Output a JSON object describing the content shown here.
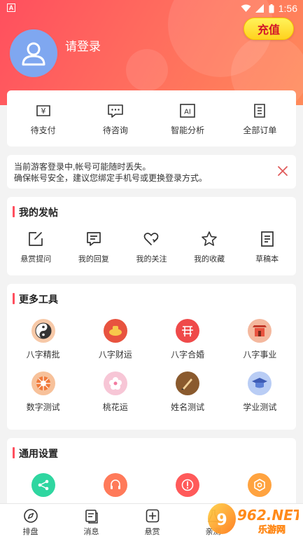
{
  "status": {
    "time": "1:56",
    "badge": "A"
  },
  "user": {
    "login_text": "请登录",
    "recharge_label": "充值"
  },
  "orders": [
    {
      "label": "待支付",
      "icon": "yuan-ticket-icon"
    },
    {
      "label": "待咨询",
      "icon": "chat-bubble-icon"
    },
    {
      "label": "智能分析",
      "icon": "ai-icon"
    },
    {
      "label": "全部订单",
      "icon": "list-doc-icon"
    }
  ],
  "notice": {
    "line1": "当前游客登录中,帐号可能随时丢失。",
    "line2": "确保帐号安全，建议您绑定手机号或更换登录方式。"
  },
  "posts": {
    "title": "我的发帖",
    "items": [
      {
        "label": "悬赏提问",
        "icon": "edit-icon"
      },
      {
        "label": "我的回复",
        "icon": "reply-icon"
      },
      {
        "label": "我的关注",
        "icon": "heart-icon"
      },
      {
        "label": "我的收藏",
        "icon": "star-icon"
      },
      {
        "label": "草稿本",
        "icon": "draft-icon"
      }
    ]
  },
  "tools": {
    "title": "更多工具",
    "items": [
      {
        "label": "八字精批",
        "icon": "yin-yang-icon",
        "color": "#f5a070"
      },
      {
        "label": "八字财运",
        "icon": "wealth-icon",
        "color": "#e8533f"
      },
      {
        "label": "八字合婚",
        "icon": "double-happiness-icon",
        "color": "#ef4a4a"
      },
      {
        "label": "八字事业",
        "icon": "gate-icon",
        "color": "#e8533f"
      },
      {
        "label": "数字测试",
        "icon": "wheel-icon",
        "color": "#f07a3a"
      },
      {
        "label": "桃花运",
        "icon": "peach-blossom-icon",
        "color": "#f7a8c0"
      },
      {
        "label": "姓名测试",
        "icon": "brush-icon",
        "color": "#d9a35e"
      },
      {
        "label": "学业测试",
        "icon": "graduation-cap-icon",
        "color": "#7fa3e8"
      }
    ]
  },
  "settings": {
    "title": "通用设置",
    "items": [
      {
        "icon": "share-icon",
        "color": "#2fd6a0"
      },
      {
        "icon": "headset-icon",
        "color": "#ff7a5a"
      },
      {
        "icon": "alert-icon",
        "color": "#ff5a5a"
      },
      {
        "icon": "settings-icon",
        "color": "#ffa340"
      }
    ]
  },
  "tabbar": [
    {
      "label": "排盘",
      "icon": "compass-icon"
    },
    {
      "label": "消息",
      "icon": "message-icon"
    },
    {
      "label": "悬赏",
      "icon": "plus-box-icon"
    },
    {
      "label": "亲测",
      "icon": "flask-icon"
    }
  ],
  "watermark": {
    "brand": "962.NET",
    "sub": "乐游网"
  }
}
